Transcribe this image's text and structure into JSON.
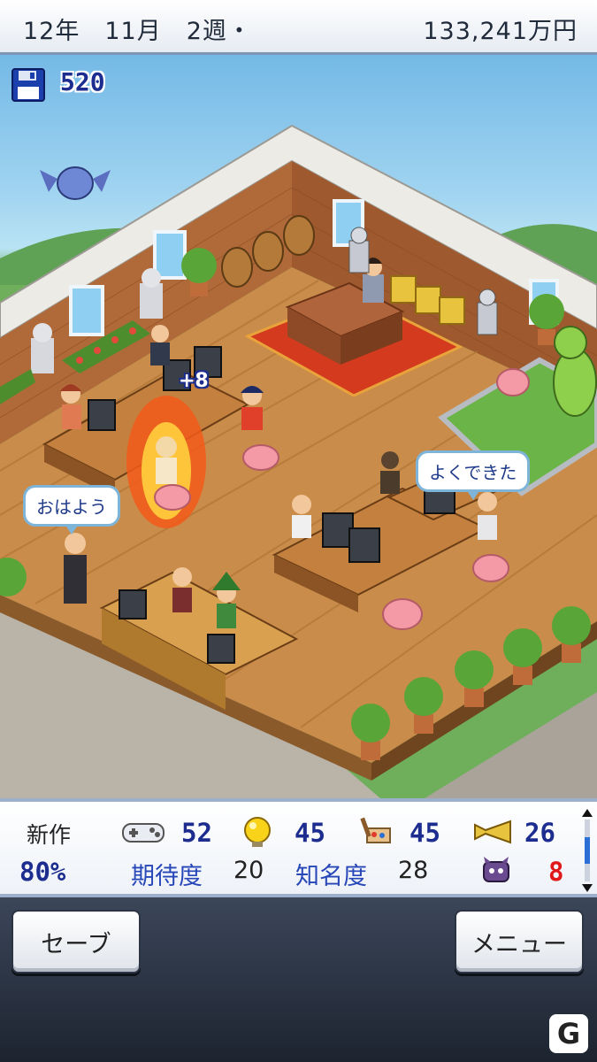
{
  "header": {
    "date": "12年　11月　2週・",
    "money": "133,241万円"
  },
  "scene": {
    "disk_count": "520",
    "bubble_left": "おはよう",
    "bubble_right": "よくできた",
    "effect_text": "+8"
  },
  "status": {
    "label_new": "新作",
    "progress": "80%",
    "stat1": "52",
    "stat2": "45",
    "stat3": "45",
    "stat4": "26",
    "expectation_label": "期待度",
    "expectation_value": "20",
    "fame_label": "知名度",
    "fame_value": "28",
    "bug_count": "8"
  },
  "buttons": {
    "save": "セーブ",
    "menu": "メニュー"
  },
  "icons": {
    "disk": "floppy-disk-icon",
    "fun": "gamepad-icon",
    "creativity": "lightbulb-icon",
    "graphics": "paint-brush-icon",
    "sound": "horn-icon",
    "bug": "bug-monster-icon"
  },
  "colors": {
    "accent_blue": "#1c2d8f",
    "bug_red": "#e01818",
    "scroll_blue": "#2b6fd6"
  }
}
